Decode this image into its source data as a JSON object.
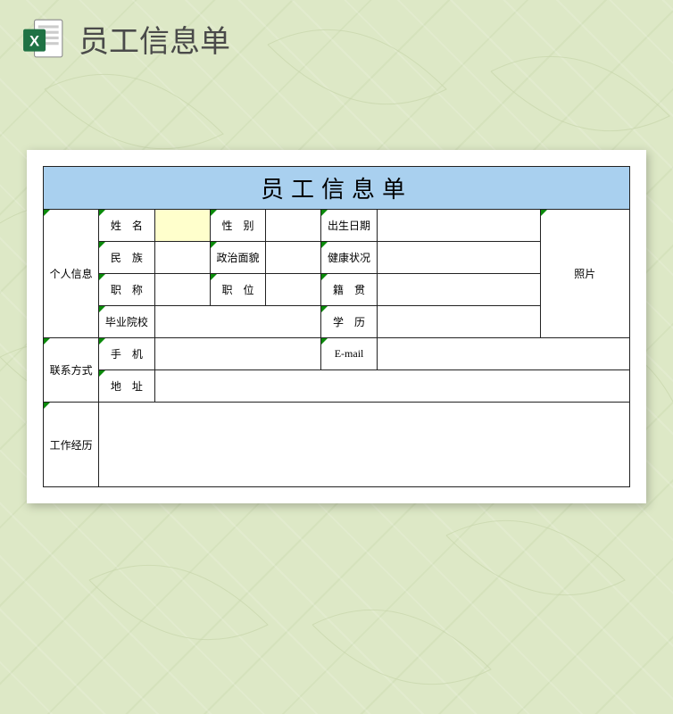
{
  "header": {
    "title": "员工信息单"
  },
  "form": {
    "title": "员工信息单",
    "sections": {
      "personal": "个人信息",
      "contact": "联系方式",
      "work": "工作经历"
    },
    "labels": {
      "name": "姓　名",
      "gender": "性　别",
      "birthdate": "出生日期",
      "ethnicity": "民　族",
      "political": "政治面貌",
      "health": "健康状况",
      "title": "职　称",
      "position": "职　位",
      "hometown": "籍　贯",
      "school": "毕业院校",
      "education": "学　历",
      "photo": "照片",
      "mobile": "手　机",
      "email": "E-mail",
      "address": "地　址"
    },
    "values": {
      "name": "",
      "gender": "",
      "birthdate": "",
      "ethnicity": "",
      "political": "",
      "health": "",
      "title": "",
      "position": "",
      "hometown": "",
      "school": "",
      "education": "",
      "mobile": "",
      "email": "",
      "address": "",
      "work_experience": ""
    }
  }
}
